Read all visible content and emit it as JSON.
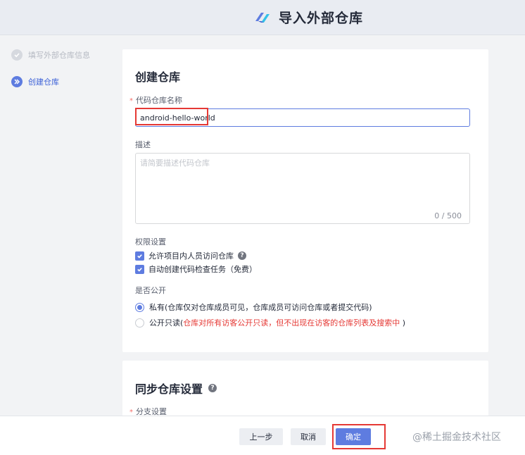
{
  "header": {
    "title": "导入外部仓库",
    "logo_icon": "devcloud-logo-icon"
  },
  "steps": [
    {
      "label": "填写外部仓库信息",
      "state": "done"
    },
    {
      "label": "创建仓库",
      "state": "active"
    }
  ],
  "create_repo": {
    "title": "创建仓库",
    "name_label": "代码仓库名称",
    "name_value": "android-hello-world",
    "desc_label": "描述",
    "desc_placeholder": "请简要描述代码仓库",
    "desc_counter": "0 / 500",
    "permission_label": "权限设置",
    "permission_options": [
      {
        "label": "允许项目内人员访问仓库",
        "checked": true,
        "help": true
      },
      {
        "label": "自动创建代码检查任务（免费）",
        "checked": true
      }
    ],
    "public_label": "是否公开",
    "visibility_private": "私有(仓库仅对仓库成员可见，仓库成员可访问仓库或者提交代码)",
    "visibility_public_prefix": "公开只读(",
    "visibility_public_warning": "仓库对所有访客公开只读，但不出现在访客的仓库列表及搜索中",
    "visibility_public_suffix": " )",
    "visibility_selected": "private"
  },
  "sync": {
    "title": "同步仓库设置",
    "branch_label": "分支设置"
  },
  "footer": {
    "prev_label": "上一步",
    "cancel_label": "取消",
    "ok_label": "确定",
    "watermark": "@稀土掘金技术社区"
  },
  "colors": {
    "accent": "#5e7ce0",
    "highlight_box": "#e53935",
    "warning_text": "#e53935"
  }
}
